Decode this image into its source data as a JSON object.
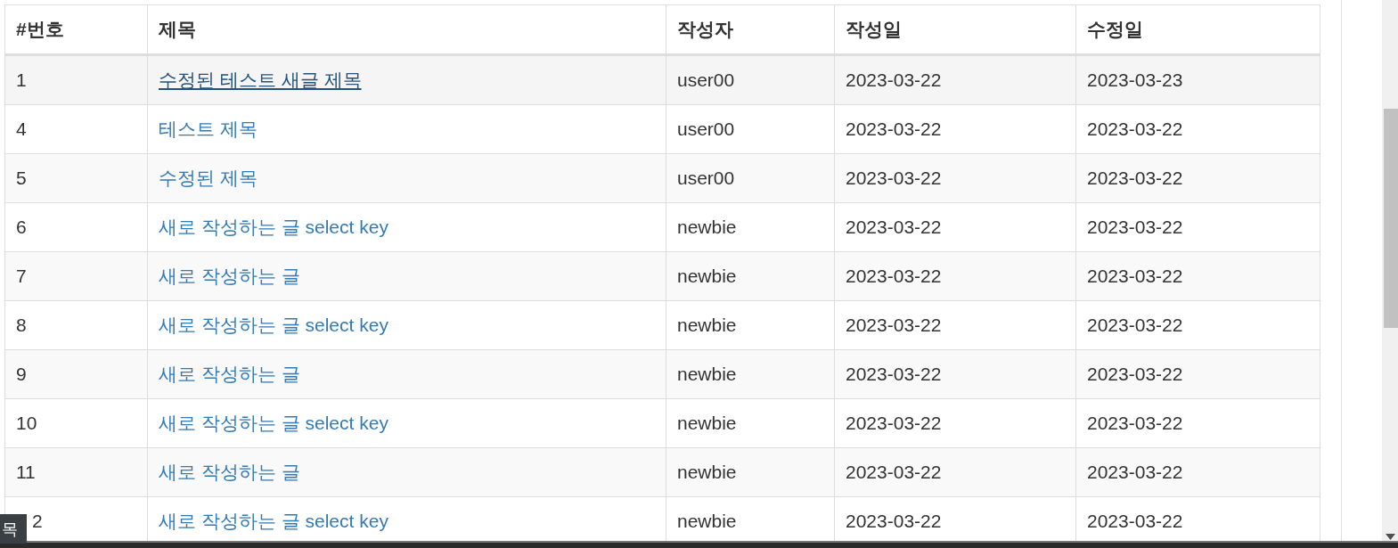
{
  "table": {
    "columns": [
      "#번호",
      "제목",
      "작성자",
      "작성일",
      "수정일"
    ],
    "rows": [
      {
        "number": "1",
        "title": "수정된 테스트 새글 제목",
        "author": "user00",
        "created": "2023-03-22",
        "modified": "2023-03-23",
        "hovered": true
      },
      {
        "number": "4",
        "title": "테스트 제목",
        "author": "user00",
        "created": "2023-03-22",
        "modified": "2023-03-22",
        "hovered": false
      },
      {
        "number": "5",
        "title": "수정된 제목",
        "author": "user00",
        "created": "2023-03-22",
        "modified": "2023-03-22",
        "hovered": false
      },
      {
        "number": "6",
        "title": "새로 작성하는 글 select key",
        "author": "newbie",
        "created": "2023-03-22",
        "modified": "2023-03-22",
        "hovered": false
      },
      {
        "number": "7",
        "title": "새로 작성하는 글",
        "author": "newbie",
        "created": "2023-03-22",
        "modified": "2023-03-22",
        "hovered": false
      },
      {
        "number": "8",
        "title": "새로 작성하는 글 select key",
        "author": "newbie",
        "created": "2023-03-22",
        "modified": "2023-03-22",
        "hovered": false
      },
      {
        "number": "9",
        "title": "새로 작성하는 글",
        "author": "newbie",
        "created": "2023-03-22",
        "modified": "2023-03-22",
        "hovered": false
      },
      {
        "number": "10",
        "title": "새로 작성하는 글 select key",
        "author": "newbie",
        "created": "2023-03-22",
        "modified": "2023-03-22",
        "hovered": false
      },
      {
        "number": "11",
        "title": "새로 작성하는 글",
        "author": "newbie",
        "created": "2023-03-22",
        "modified": "2023-03-22",
        "hovered": false
      },
      {
        "number": "2",
        "number_covered": true,
        "title": "새로 작성하는 글 select key",
        "author": "newbie",
        "created": "2023-03-22",
        "modified": "2023-03-22",
        "hovered": false
      }
    ]
  },
  "tooltip": {
    "text": "목"
  }
}
